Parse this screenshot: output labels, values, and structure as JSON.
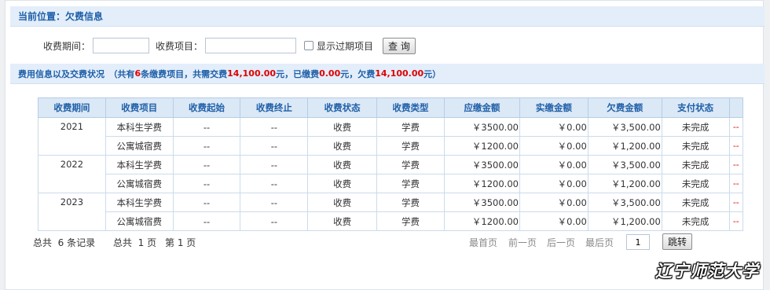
{
  "location": {
    "label": "当前位置：",
    "value": "欠费信息"
  },
  "filters": {
    "period_label": "收费期间：",
    "period_value": "",
    "item_label": "收费项目：",
    "item_value": "",
    "expired_label": "显示过期项目",
    "expired_checked": false,
    "query_button": "查 询"
  },
  "summary": {
    "prefix": "费用信息以及交费状况　（共有",
    "count": "6",
    "mid1": "条缴费项目，共需交费",
    "total_due": "14,100.00",
    "mid2": "元，已缴费",
    "paid": "0.00",
    "mid3": "元，欠费",
    "owed": "14,100.00",
    "suffix": "元）"
  },
  "table": {
    "headers": [
      "收费期间",
      "收费项目",
      "收费起始",
      "收费终止",
      "收费状态",
      "收费类型",
      "应缴金额",
      "实缴金额",
      "欠费金额",
      "支付状态",
      ""
    ],
    "groups": [
      {
        "period": "2021",
        "rows": [
          [
            "本科生学费",
            "--",
            "--",
            "收费",
            "学费",
            "￥3500.00",
            "￥0.00",
            "￥3,500.00",
            "未完成",
            "--"
          ],
          [
            "公寓城宿费",
            "--",
            "--",
            "收费",
            "学费",
            "￥1200.00",
            "￥0.00",
            "￥1,200.00",
            "未完成",
            "--"
          ]
        ]
      },
      {
        "period": "2022",
        "rows": [
          [
            "本科生学费",
            "--",
            "--",
            "收费",
            "学费",
            "￥3500.00",
            "￥0.00",
            "￥3,500.00",
            "未完成",
            "--"
          ],
          [
            "公寓城宿费",
            "--",
            "--",
            "收费",
            "学费",
            "￥1200.00",
            "￥0.00",
            "￥1,200.00",
            "未完成",
            "--"
          ]
        ]
      },
      {
        "period": "2023",
        "rows": [
          [
            "本科生学费",
            "--",
            "--",
            "收费",
            "学费",
            "￥3500.00",
            "￥0.00",
            "￥3,500.00",
            "未完成",
            "--"
          ],
          [
            "公寓城宿费",
            "--",
            "--",
            "收费",
            "学费",
            "￥1200.00",
            "￥0.00",
            "￥1,200.00",
            "未完成",
            "--"
          ]
        ]
      }
    ]
  },
  "footer": {
    "total_records": "总共  6 条记录",
    "total_pages": "总共  1 页",
    "current_page": "第 1 页",
    "first": "最首页",
    "prev": "前一页",
    "next": "后一页",
    "last": "最后页",
    "page_input": "1",
    "jump_button": "跳转"
  },
  "watermark": "辽宁师范大学",
  "colors": {
    "accent": "#1f5fa8",
    "header_bg": "#e3eefa",
    "highlight": "#e00000"
  }
}
